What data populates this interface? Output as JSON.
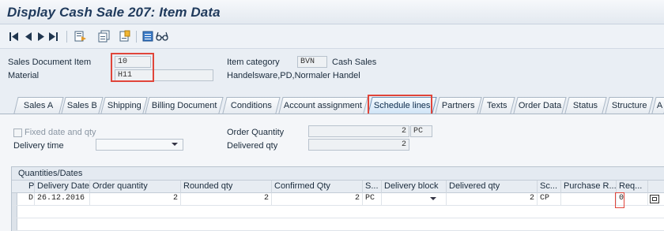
{
  "window": {
    "title": "Display Cash Sale 207: Item Data"
  },
  "toolbar": {
    "icons": [
      "first-item-icon",
      "previous-item-icon",
      "next-item-icon",
      "last-item-icon",
      "header-details-icon",
      "item-overview-icon",
      "document-flow-icon",
      "display-object-icon",
      "configuration-glasses-icon"
    ]
  },
  "header": {
    "sales_doc_item_label": "Sales Document Item",
    "sales_doc_item_value": "10",
    "material_label": "Material",
    "material_value": "H11",
    "item_category_label": "Item category",
    "item_category_value": "BVN",
    "item_category_text": "Cash Sales",
    "material_text": "Handelsware,PD,Normaler Handel"
  },
  "tabs": [
    {
      "label": "Sales A"
    },
    {
      "label": "Sales B"
    },
    {
      "label": "Shipping"
    },
    {
      "label": "Billing Document"
    },
    {
      "label": "Conditions"
    },
    {
      "label": "Account assignment"
    },
    {
      "label": "Schedule lines",
      "active": true
    },
    {
      "label": "Partners"
    },
    {
      "label": "Texts"
    },
    {
      "label": "Order Data"
    },
    {
      "label": "Status"
    },
    {
      "label": "Structure"
    },
    {
      "label": "A"
    }
  ],
  "schedule": {
    "fixed_date_label": "Fixed date and qty",
    "delivery_time_label": "Delivery time",
    "delivery_time_value": "",
    "order_qty_label": "Order Quantity",
    "order_qty_value": "2",
    "order_qty_unit": "PC",
    "delivered_qty_label": "Delivered qty",
    "delivered_qty_value": "2"
  },
  "grid": {
    "title": "Quantities/Dates",
    "columns": [
      "P",
      "Delivery Date",
      "Order quantity",
      "Rounded qty",
      "Confirmed Qty",
      "S...",
      "Delivery block",
      "Delivered qty",
      "Sc...",
      "Purchase R...",
      "Req..."
    ],
    "rows": [
      [
        "D",
        "26.12.2016",
        "2",
        "2",
        "2",
        "PC",
        "",
        "2",
        "CP",
        "",
        "0"
      ]
    ]
  },
  "colors": {
    "highlight": "#e0453a",
    "active_tab": "#cfe4f6",
    "title": "#1f3a5c"
  }
}
